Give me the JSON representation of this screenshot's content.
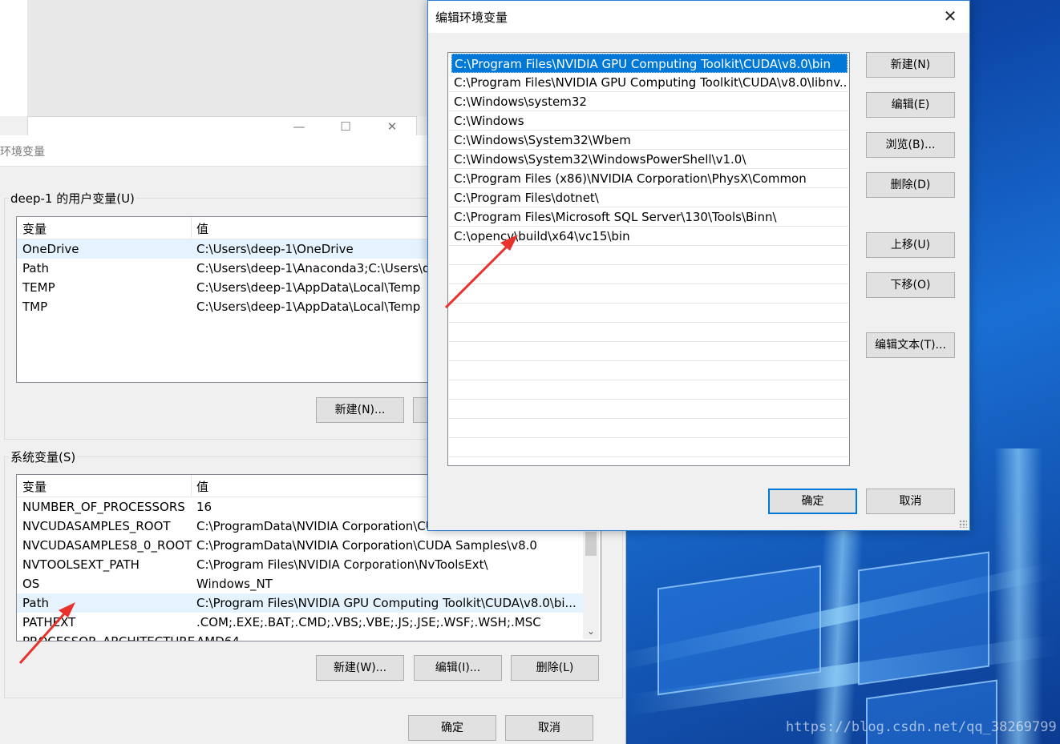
{
  "env_window": {
    "title": "环境变量",
    "user_group_label": "deep-1 的用户变量(U)",
    "user_headers": [
      "变量",
      "值"
    ],
    "user_vars": [
      {
        "name": "OneDrive",
        "value": "C:\\Users\\deep-1\\OneDrive"
      },
      {
        "name": "Path",
        "value": "C:\\Users\\deep-1\\Anaconda3;C:\\Users\\d"
      },
      {
        "name": "TEMP",
        "value": "C:\\Users\\deep-1\\AppData\\Local\\Temp"
      },
      {
        "name": "TMP",
        "value": "C:\\Users\\deep-1\\AppData\\Local\\Temp"
      }
    ],
    "user_new_button": "新建(N)...",
    "system_group_label": "系统变量(S)",
    "system_headers": [
      "变量",
      "值"
    ],
    "system_vars": [
      {
        "name": "NUMBER_OF_PROCESSORS",
        "value": "16"
      },
      {
        "name": "NVCUDASAMPLES_ROOT",
        "value": "C:\\ProgramData\\NVIDIA Corporation\\CU"
      },
      {
        "name": "NVCUDASAMPLES8_0_ROOT",
        "value": "C:\\ProgramData\\NVIDIA Corporation\\CUDA Samples\\v8.0"
      },
      {
        "name": "NVTOOLSEXT_PATH",
        "value": "C:\\Program Files\\NVIDIA Corporation\\NvToolsExt\\"
      },
      {
        "name": "OS",
        "value": "Windows_NT"
      },
      {
        "name": "Path",
        "value": "C:\\Program Files\\NVIDIA GPU Computing Toolkit\\CUDA\\v8.0\\bi..."
      },
      {
        "name": "PATHEXT",
        "value": ".COM;.EXE;.BAT;.CMD;.VBS;.VBE;.JS;.JSE;.WSF;.WSH;.MSC"
      },
      {
        "name": "PROCESSOR_ARCHITECTURE",
        "value": "AMD64"
      }
    ],
    "system_new_button": "新建(W)...",
    "system_edit_button": "编辑(I)...",
    "system_delete_button": "删除(L)",
    "ok_button": "确定",
    "cancel_button": "取消"
  },
  "edit_dialog": {
    "title": "编辑环境变量",
    "paths": [
      "C:\\Program Files\\NVIDIA GPU Computing Toolkit\\CUDA\\v8.0\\bin",
      "C:\\Program Files\\NVIDIA GPU Computing Toolkit\\CUDA\\v8.0\\libnv...",
      "C:\\Windows\\system32",
      "C:\\Windows",
      "C:\\Windows\\System32\\Wbem",
      "C:\\Windows\\System32\\WindowsPowerShell\\v1.0\\",
      "C:\\Program Files (x86)\\NVIDIA Corporation\\PhysX\\Common",
      "C:\\Program Files\\dotnet\\",
      "C:\\Program Files\\Microsoft SQL Server\\130\\Tools\\Binn\\",
      "C:\\opencv\\build\\x64\\vc15\\bin"
    ],
    "buttons": {
      "new": "新建(N)",
      "edit": "编辑(E)",
      "browse": "浏览(B)...",
      "delete": "删除(D)",
      "move_up": "上移(U)",
      "move_down": "下移(O)",
      "edit_text": "编辑文本(T)...",
      "ok": "确定",
      "cancel": "取消"
    }
  },
  "watermark": "https://blog.csdn.net/qq_38269799",
  "colors": {
    "accent": "#0078d7",
    "annotation": "#e8322c",
    "window_bg": "#f0f0f0"
  }
}
